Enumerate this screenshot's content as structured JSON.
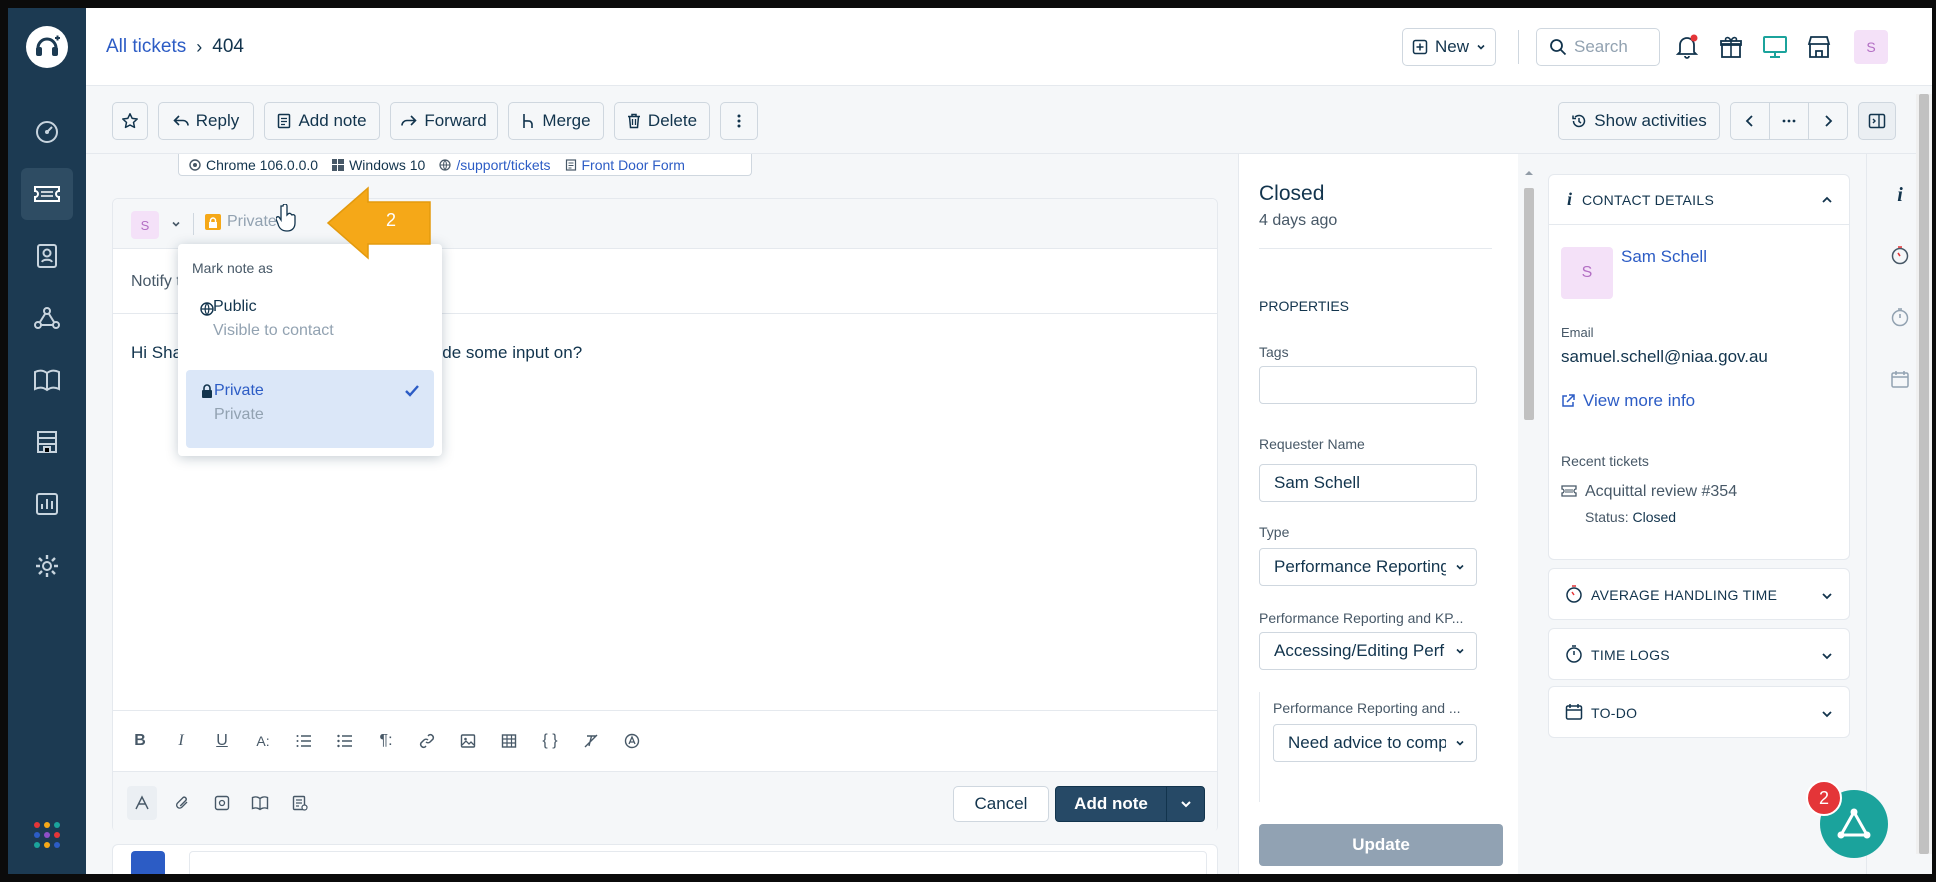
{
  "breadcrumb": {
    "parent": "All tickets",
    "separator": "›",
    "current": "404"
  },
  "header": {
    "new_label": "New",
    "search_placeholder": "Search",
    "avatar_letter": "S"
  },
  "toolbar": {
    "reply": "Reply",
    "add_note": "Add note",
    "forward": "Forward",
    "merge": "Merge",
    "delete": "Delete",
    "show_activities": "Show activities"
  },
  "meta": {
    "browser": "Chrome 106.0.0.0",
    "os": "Windows 10",
    "url": "/support/tickets",
    "form": "Front Door Form"
  },
  "editor": {
    "avatar_letter": "S",
    "visibility": "Private",
    "notify_label": "Notify to:",
    "body_start": "Hi Shae, is",
    "body_end": "vide some input on?",
    "cancel": "Cancel",
    "submit": "Add note"
  },
  "dropdown": {
    "title": "Mark note as",
    "options": [
      {
        "label": "Public",
        "sub": "Visible to contact",
        "selected": false
      },
      {
        "label": "Private",
        "sub": "Private",
        "selected": true
      }
    ]
  },
  "callout": {
    "number": "2",
    "color": "#f5a818"
  },
  "properties": {
    "status": "Closed",
    "status_time": "4 days ago",
    "heading": "PROPERTIES",
    "tags_label": "Tags",
    "requester_label": "Requester Name",
    "requester_value": "Sam Schell",
    "type_label": "Type",
    "type_value": "Performance Reporting",
    "kp_label": "Performance Reporting and KP...",
    "kp_value": "Accessing/Editing Perf",
    "sub_label": "Performance Reporting and ...",
    "sub_value": "Need advice to comp",
    "update": "Update"
  },
  "contact": {
    "heading": "CONTACT DETAILS",
    "avatar_letter": "S",
    "name": "Sam Schell",
    "email_label": "Email",
    "email": "samuel.schell@niaa.gov.au",
    "view_more": "View more info",
    "recent_label": "Recent tickets",
    "recent_ticket": "Acquittal review #354",
    "recent_status_label": "Status:",
    "recent_status": "Closed"
  },
  "sections": {
    "aht": "AVERAGE HANDLING TIME",
    "time_logs": "TIME LOGS",
    "todo": "TO-DO"
  },
  "fab_badge": "2",
  "colors": {
    "sidebar": "#1c3a52",
    "link": "#2c5cc5",
    "primary": "#264966",
    "accent": "#1ba39c",
    "selected_bg": "#dbe7f8"
  }
}
